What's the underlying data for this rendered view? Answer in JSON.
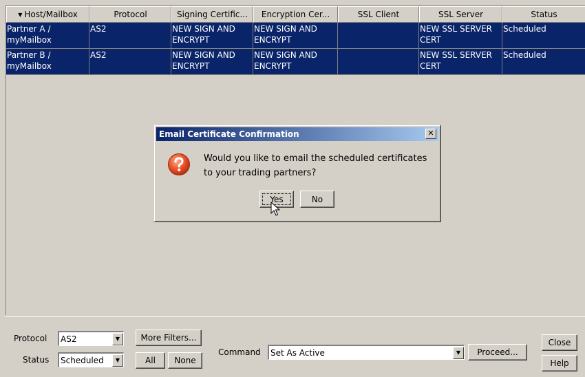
{
  "table": {
    "columns": [
      {
        "label": "Host/Mailbox",
        "sorted": true,
        "w": 121
      },
      {
        "label": "Protocol",
        "w": 119
      },
      {
        "label": "Signing Certific...",
        "w": 119
      },
      {
        "label": "Encryption Cer...",
        "w": 123
      },
      {
        "label": "SSL Client",
        "w": 118
      },
      {
        "label": "SSL Server",
        "w": 121
      },
      {
        "label": "Status",
        "w": 121
      }
    ],
    "rows": [
      {
        "host": [
          "Partner A /",
          "myMailbox"
        ],
        "protocol": [
          "AS2"
        ],
        "signing": [
          "NEW SIGN AND",
          "ENCRYPT"
        ],
        "encryption": [
          "NEW SIGN AND",
          "ENCRYPT"
        ],
        "ssl_client": [
          ""
        ],
        "ssl_server": [
          "NEW SSL SERVER",
          "CERT"
        ],
        "status": [
          "Scheduled"
        ]
      },
      {
        "host": [
          "Partner B /",
          "myMailbox"
        ],
        "protocol": [
          "AS2"
        ],
        "signing": [
          "NEW SIGN AND",
          "ENCRYPT"
        ],
        "encryption": [
          "NEW SIGN AND",
          "ENCRYPT"
        ],
        "ssl_client": [
          ""
        ],
        "ssl_server": [
          "NEW SSL SERVER",
          "CERT"
        ],
        "status": [
          "Scheduled"
        ]
      }
    ]
  },
  "filters": {
    "protocol_label": "Protocol",
    "protocol_value": "AS2",
    "status_label": "Status",
    "status_value": "Scheduled",
    "more_filters": "More Filters...",
    "all": "All",
    "none": "None"
  },
  "command": {
    "label": "Command",
    "value": "Set As Active",
    "proceed": "Proceed..."
  },
  "actions": {
    "close": "Close",
    "help": "Help"
  },
  "dialog": {
    "title": "Email Certificate Confirmation",
    "close_glyph": "✕",
    "message_line1": "Would you like to email the scheduled certificates",
    "message_line2": "to your trading partners?",
    "yes": "Yes",
    "no": "No",
    "icon": "question-icon"
  },
  "colors": {
    "selection": "#0a246a",
    "face": "#d4d0c8",
    "question_icon": "#e8502a"
  }
}
